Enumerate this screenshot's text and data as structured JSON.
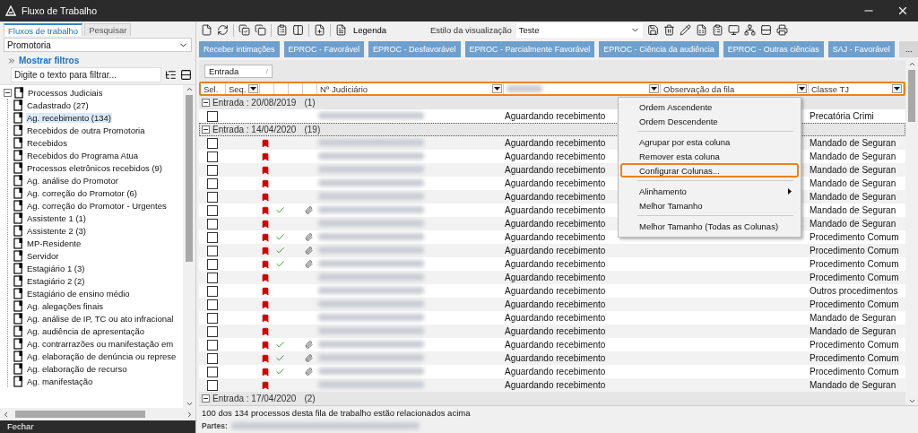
{
  "window": {
    "title": "Fluxo de Trabalho"
  },
  "sidebar": {
    "tabs": [
      {
        "label": "Fluxos de trabalho",
        "selected": true
      },
      {
        "label": "Pesquisar",
        "selected": false
      }
    ],
    "dropdown": {
      "value": "Promotoria"
    },
    "filters_link": "Mostrar filtros",
    "filter": {
      "placeholder": "Digite o texto para filtrar..."
    },
    "tree": [
      {
        "label": "Processos Judiciais",
        "expanded": true,
        "selected": false,
        "children": [
          {
            "label": "Cadastrado (27)",
            "selected": false
          },
          {
            "label": "Ag. recebimento (134)",
            "selected": true
          },
          {
            "label": "Recebidos de outra Promotoria",
            "selected": false
          },
          {
            "label": "Recebidos",
            "selected": false
          },
          {
            "label": "Recebidos do Programa Atua",
            "selected": false
          },
          {
            "label": "Processos eletrônicos recebidos (9)",
            "selected": false
          },
          {
            "label": "Ag. análise do Promotor",
            "selected": false
          },
          {
            "label": "Ag. correção do Promotor (6)",
            "selected": false
          },
          {
            "label": "Ag. correção do Promotor - Urgentes",
            "selected": false
          },
          {
            "label": "Assistente 1 (1)",
            "selected": false
          },
          {
            "label": "Assistente 2 (3)",
            "selected": false
          },
          {
            "label": "MP-Residente",
            "selected": false
          },
          {
            "label": "Servidor",
            "selected": false
          },
          {
            "label": "Estagiário 1 (3)",
            "selected": false
          },
          {
            "label": "Estagiário 2 (2)",
            "selected": false
          },
          {
            "label": "Estagiário de ensino médio",
            "selected": false
          },
          {
            "label": "Ag. alegações finais",
            "selected": false
          },
          {
            "label": "Ag. análise de IP, TC ou ato infracional",
            "selected": false
          },
          {
            "label": "Ag. audiência de apresentação",
            "selected": false
          },
          {
            "label": "Ag. contrarrazões ou manifestação em",
            "selected": false
          },
          {
            "label": "Ag. elaboração de denúncia ou represe",
            "selected": false
          },
          {
            "label": "Ag. elaboração de recurso",
            "selected": false
          },
          {
            "label": "Ag. manifestação",
            "selected": false
          }
        ]
      }
    ],
    "footer": "Fechar"
  },
  "toolbar": {
    "legend": "Legenda",
    "style_label": "Estilo da visualização",
    "style_value": "Teste"
  },
  "quick_buttons": [
    {
      "label": "Receber intimações",
      "kind": "action"
    },
    {
      "label": "EPROC - Favorável",
      "kind": "action"
    },
    {
      "label": "EPROC - Desfavorável",
      "kind": "action"
    },
    {
      "label": "EPROC - Parcialmente Favorável",
      "kind": "action"
    },
    {
      "label": "EPROC - Ciência da audiência",
      "kind": "action"
    },
    {
      "label": "EPROC - Outras ciências",
      "kind": "action"
    },
    {
      "label": "SAJ - Favorável",
      "kind": "action"
    },
    {
      "label": "...",
      "kind": "more"
    }
  ],
  "group_by": {
    "chips": [
      {
        "label": "Entrada",
        "sort": "/"
      }
    ]
  },
  "table": {
    "highlighted": true,
    "columns": [
      {
        "kind": "text",
        "label": "Sel.",
        "filter": false
      },
      {
        "kind": "text",
        "label": "Seq.",
        "filter": true
      },
      {
        "kind": "icon"
      },
      {
        "kind": "icon"
      },
      {
        "kind": "icon"
      },
      {
        "kind": "icon"
      },
      {
        "kind": "text",
        "label": "Nº Judiciário",
        "filter": true
      },
      {
        "kind": "blurred",
        "filter": true
      },
      {
        "kind": "text",
        "label": "Observação da fila",
        "filter": true
      },
      {
        "kind": "text",
        "label": "Classe TJ",
        "filter": true
      }
    ],
    "groups": [
      {
        "label": "Entrada : 20/08/2019",
        "count": "(1)",
        "expanded": true,
        "focused": false,
        "rows": [
          {
            "checked": false,
            "flag": false,
            "done": false,
            "attachment": false,
            "status": "Aguardando recebimento",
            "class": "Precatória Crimi"
          }
        ]
      },
      {
        "label": "Entrada : 14/04/2020",
        "count": "(19)",
        "expanded": true,
        "focused": true,
        "rows": [
          {
            "checked": false,
            "flag": true,
            "done": false,
            "attachment": false,
            "status": "Aguardando recebimento",
            "class": "Mandado de Seguran"
          },
          {
            "checked": false,
            "flag": true,
            "done": false,
            "attachment": false,
            "status": "Aguardando recebimento",
            "class": "Mandado de Seguran"
          },
          {
            "checked": false,
            "flag": true,
            "done": false,
            "attachment": false,
            "status": "Aguardando recebimento",
            "class": "Mandado de Seguran"
          },
          {
            "checked": false,
            "flag": true,
            "done": false,
            "attachment": false,
            "status": "Aguardando recebimento",
            "class": "Mandado de Seguran"
          },
          {
            "checked": false,
            "flag": true,
            "done": false,
            "attachment": false,
            "status": "Aguardando recebimento",
            "class": "Mandado de Seguran"
          },
          {
            "checked": false,
            "flag": true,
            "done": true,
            "attachment": true,
            "status": "Aguardando recebimento",
            "class": "Mandado de Seguran"
          },
          {
            "checked": false,
            "flag": true,
            "done": false,
            "attachment": false,
            "status": "Aguardando recebimento",
            "class": "Mandado de Seguran"
          },
          {
            "checked": false,
            "flag": true,
            "done": true,
            "attachment": true,
            "status": "Aguardando recebimento",
            "class": "Procedimento Comum"
          },
          {
            "checked": false,
            "flag": true,
            "done": true,
            "attachment": true,
            "status": "Aguardando recebimento",
            "class": "Procedimento Comum"
          },
          {
            "checked": false,
            "flag": true,
            "done": true,
            "attachment": true,
            "status": "Aguardando recebimento",
            "class": "Procedimento Comum"
          },
          {
            "checked": false,
            "flag": true,
            "done": false,
            "attachment": false,
            "status": "Aguardando recebimento",
            "class": "Procedimento Comum"
          },
          {
            "checked": false,
            "flag": true,
            "done": false,
            "attachment": false,
            "status": "Aguardando recebimento",
            "class": "Outros procedimentos"
          },
          {
            "checked": false,
            "flag": true,
            "done": false,
            "attachment": false,
            "status": "Aguardando recebimento",
            "class": "Procedimento Comum"
          },
          {
            "checked": false,
            "flag": true,
            "done": false,
            "attachment": false,
            "status": "Aguardando recebimento",
            "class": "Mandado de Seguran"
          },
          {
            "checked": false,
            "flag": true,
            "done": false,
            "attachment": false,
            "status": "Aguardando recebimento",
            "class": "Mandado de Seguran"
          },
          {
            "checked": false,
            "flag": true,
            "done": true,
            "attachment": true,
            "status": "Aguardando recebimento",
            "class": "Procedimento Comum"
          },
          {
            "checked": false,
            "flag": true,
            "done": true,
            "attachment": true,
            "status": "Aguardando recebimento",
            "class": "Procedimento Comum"
          },
          {
            "checked": false,
            "flag": true,
            "done": true,
            "attachment": true,
            "status": "Aguardando recebimento",
            "class": "Procedimento Comum"
          },
          {
            "checked": false,
            "flag": true,
            "done": false,
            "attachment": false,
            "status": "Aguardando recebimento",
            "class": "Mandado de Seguran"
          }
        ]
      },
      {
        "label": "Entrada : 17/04/2020",
        "count": "(2)",
        "expanded": true,
        "focused": false
      }
    ]
  },
  "context_menu": {
    "items": [
      {
        "kind": "item",
        "label": "Ordem Ascendente",
        "selected": false
      },
      {
        "kind": "item",
        "label": "Ordem Descendente",
        "selected": false
      },
      {
        "kind": "separator"
      },
      {
        "kind": "item",
        "label": "Agrupar por esta coluna",
        "selected": false
      },
      {
        "kind": "item",
        "label": "Remover esta coluna",
        "selected": false
      },
      {
        "kind": "item",
        "label": "Configurar Colunas...",
        "selected": true
      },
      {
        "kind": "separator"
      },
      {
        "kind": "submenu",
        "label": "Alinhamento",
        "selected": false
      },
      {
        "kind": "item",
        "label": "Melhor Tamanho",
        "selected": false
      },
      {
        "kind": "separator"
      },
      {
        "kind": "item",
        "label": "Melhor Tamanho (Todas as Colunas)",
        "selected": false
      }
    ]
  },
  "status_bar": {
    "summary": "100 dos 134 processos desta fila de trabalho estão relacionados acima",
    "parties_label": "Partes:"
  }
}
